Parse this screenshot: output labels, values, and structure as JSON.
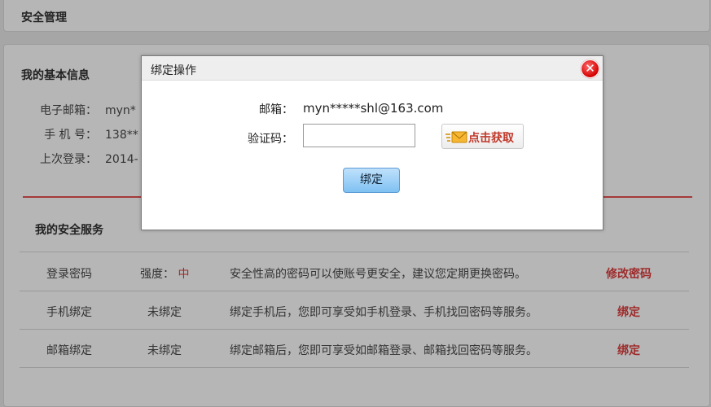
{
  "header": {
    "title": "安全管理"
  },
  "basic_info": {
    "title": "我的基本信息",
    "rows": [
      {
        "label": "电子邮箱：",
        "value": "myn*"
      },
      {
        "label": "手 机 号：",
        "value": "138**"
      },
      {
        "label": "上次登录：",
        "value": "2014-"
      }
    ]
  },
  "security": {
    "title": "我的安全服务",
    "rows": [
      {
        "name": "登录密码",
        "status_prefix": "强度：",
        "status": "中",
        "description": "安全性高的密码可以使账号更安全，建议您定期更换密码。",
        "action": "修改密码"
      },
      {
        "name": "手机绑定",
        "status_prefix": "",
        "status": "未绑定",
        "description": "绑定手机后，您即可享受如手机登录、手机找回密码等服务。",
        "action": "绑定"
      },
      {
        "name": "邮箱绑定",
        "status_prefix": "",
        "status": "未绑定",
        "description": "绑定邮箱后，您即可享受如邮箱登录、邮箱找回密码等服务。",
        "action": "绑定"
      }
    ]
  },
  "modal": {
    "title": "绑定操作",
    "close_icon": "close-icon",
    "email_label": "邮箱：",
    "email_value": "myn*****shl@163.com",
    "code_label": "验证码：",
    "code_value": "",
    "code_placeholder": "",
    "get_code_label": "点击获取",
    "get_code_icon": "envelope-icon",
    "bind_label": "绑定"
  },
  "colors": {
    "accent_red": "#9e2a2a",
    "bind_button": "#7fc1f2",
    "close_button": "#d40000"
  }
}
